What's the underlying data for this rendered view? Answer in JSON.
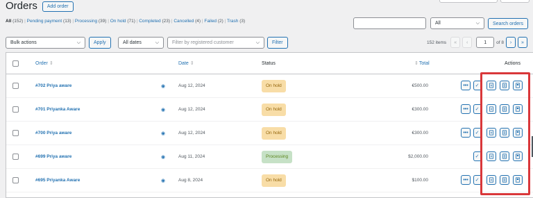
{
  "page": {
    "title": "Orders",
    "add_order_label": "Add order"
  },
  "status_filters": [
    {
      "label": "All",
      "count": "(152)"
    },
    {
      "label": "Pending payment",
      "count": "(13)"
    },
    {
      "label": "Processing",
      "count": "(39)"
    },
    {
      "label": "On hold",
      "count": "(71)"
    },
    {
      "label": "Completed",
      "count": "(23)"
    },
    {
      "label": "Cancelled",
      "count": "(4)"
    },
    {
      "label": "Failed",
      "count": "(2)"
    },
    {
      "label": "Trash",
      "count": "(3)"
    }
  ],
  "search": {
    "input_value": "",
    "scope_select": "All",
    "button_label": "Search orders"
  },
  "filters": {
    "bulk_actions": "Bulk actions",
    "apply_label": "Apply",
    "dates": "All dates",
    "customer_placeholder": "Filter by registered customer",
    "filter_label": "Filter"
  },
  "pagination": {
    "items_text": "152 items",
    "first": "«",
    "prev": "‹",
    "current_page": "1",
    "of_text": "of 8",
    "next": "›",
    "last": "»"
  },
  "columns": {
    "order": "Order",
    "date": "Date",
    "status": "Status",
    "total": "Total",
    "actions": "Actions"
  },
  "rows": [
    {
      "order": "#702 Priya aware",
      "date": "Aug 12, 2024",
      "status": "On hold",
      "status_type": "hold",
      "total": "€500.00"
    },
    {
      "order": "#701 Priyanka Aware",
      "date": "Aug 12, 2024",
      "status": "On hold",
      "status_type": "hold",
      "total": "€300.00"
    },
    {
      "order": "#700 Priya aware",
      "date": "Aug 12, 2024",
      "status": "On hold",
      "status_type": "hold",
      "total": "€300.00"
    },
    {
      "order": "#699 Priya aware",
      "date": "Aug 11, 2024",
      "status": "Processing",
      "status_type": "proc",
      "total": "$2,000.00"
    },
    {
      "order": "#695 Priyanka Aware",
      "date": "Aug 8, 2024",
      "status": "On hold",
      "status_type": "hold",
      "total": "$100.00"
    }
  ],
  "icons": {
    "sort": "sort-arrows-icon",
    "preview": "eye-icon",
    "more": "ellipsis-icon",
    "complete": "checkmark-icon",
    "invoice": "document-icon",
    "packing_slip": "list-document-icon",
    "label": "label-icon"
  },
  "colors": {
    "accent": "#2271b1",
    "on_hold_bg": "#f8dda7",
    "processing_bg": "#c6e1c6",
    "highlight": "#d9373a"
  }
}
